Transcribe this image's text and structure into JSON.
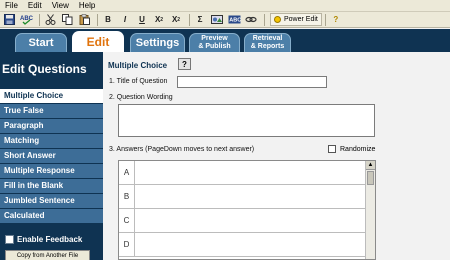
{
  "menu": [
    "File",
    "Edit",
    "View",
    "Help"
  ],
  "toolbar": {
    "power_edit": "Power Edit",
    "help_glyph": "?"
  },
  "tabs": {
    "start": "Start",
    "edit": "Edit",
    "settings": "Settings",
    "preview": [
      "Preview",
      "& Publish"
    ],
    "retrieval": [
      "Retrieval",
      "& Reports"
    ]
  },
  "sidebar": {
    "title": "Edit Questions",
    "items": [
      "Multiple Choice",
      "True False",
      "Paragraph",
      "Matching",
      "Short Answer",
      "Multiple Response",
      "Fill in the Blank",
      "Jumbled Sentence",
      "Calculated"
    ],
    "enable_feedback": "Enable Feedback",
    "copy_button": "Copy from Another File"
  },
  "main": {
    "header": "Multiple Choice",
    "help": "?",
    "title_label": "1.  Title of Question",
    "title_value": "",
    "wording_label": "2.  Question Wording",
    "answers_label": "3.  Answers  (PageDown moves to next answer)",
    "randomize": "Randomize",
    "answer_letters": [
      "A",
      "B",
      "C",
      "D"
    ]
  },
  "colors": {
    "navy": "#0f3352",
    "tab_active_text": "#e0730c",
    "sidebar_item": "#3d6d97"
  }
}
